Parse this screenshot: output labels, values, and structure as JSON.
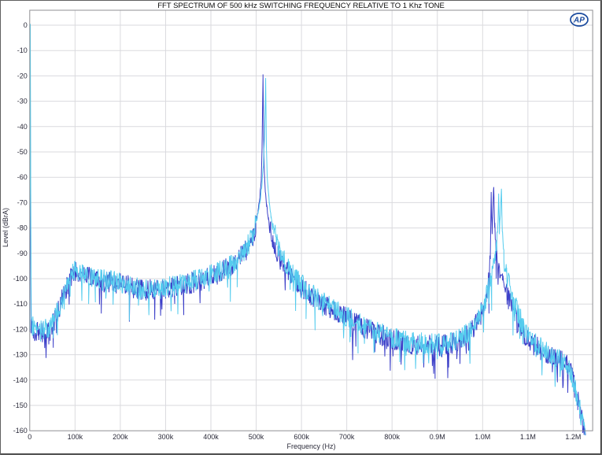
{
  "logo": {
    "text": "AP"
  },
  "chart_data": {
    "type": "line",
    "title": "FFT SPECTRUM OF 500 kHz SWITCHING FREQUENCY RELATIVE TO 1 Khz TONE",
    "xlabel": "Frequency (Hz)",
    "ylabel": "Level (dBrA)",
    "xlim_hz": [
      0,
      1243000
    ],
    "ylim_db": [
      -160,
      6
    ],
    "grid": true,
    "legend": "none",
    "x_ticks": [
      {
        "hz": 0,
        "label": "0"
      },
      {
        "hz": 100000,
        "label": "100k"
      },
      {
        "hz": 200000,
        "label": "200k"
      },
      {
        "hz": 300000,
        "label": "300k"
      },
      {
        "hz": 400000,
        "label": "400k"
      },
      {
        "hz": 500000,
        "label": "500k"
      },
      {
        "hz": 600000,
        "label": "600k"
      },
      {
        "hz": 700000,
        "label": "700k"
      },
      {
        "hz": 800000,
        "label": "800k"
      },
      {
        "hz": 900000,
        "label": "0.9M"
      },
      {
        "hz": 1000000,
        "label": "1.0M"
      },
      {
        "hz": 1100000,
        "label": "1.1M"
      },
      {
        "hz": 1200000,
        "label": "1.2M"
      }
    ],
    "y_ticks": [
      {
        "db": 0,
        "label": "0"
      },
      {
        "db": -10,
        "label": "-10"
      },
      {
        "db": -20,
        "label": "-20"
      },
      {
        "db": -30,
        "label": "-30"
      },
      {
        "db": -40,
        "label": "-40"
      },
      {
        "db": -50,
        "label": "-50"
      },
      {
        "db": -60,
        "label": "-60"
      },
      {
        "db": -70,
        "label": "-70"
      },
      {
        "db": -80,
        "label": "-80"
      },
      {
        "db": -90,
        "label": "-90"
      },
      {
        "db": -100,
        "label": "-100"
      },
      {
        "db": -110,
        "label": "-110"
      },
      {
        "db": -120,
        "label": "-120"
      },
      {
        "db": -130,
        "label": "-130"
      },
      {
        "db": -140,
        "label": "-140"
      },
      {
        "db": -150,
        "label": "-150"
      },
      {
        "db": -160,
        "label": "-160"
      }
    ],
    "series": [
      {
        "name": "fft-trace-blue",
        "color": "#3c3fc8",
        "noise_db": 4.3,
        "points_khz_db": [
          [
            0,
            -118
          ],
          [
            0.6,
            -60
          ],
          [
            1,
            -1
          ],
          [
            1.6,
            -70
          ],
          [
            3,
            -119
          ],
          [
            8,
            -120
          ],
          [
            15,
            -121
          ],
          [
            22,
            -122
          ],
          [
            30,
            -121
          ],
          [
            38,
            -120
          ],
          [
            45,
            -119
          ],
          [
            52,
            -117
          ],
          [
            60,
            -114
          ],
          [
            68,
            -110
          ],
          [
            76,
            -106
          ],
          [
            84,
            -102
          ],
          [
            92,
            -99
          ],
          [
            100,
            -97
          ],
          [
            108,
            -98
          ],
          [
            118,
            -99
          ],
          [
            130,
            -99.5
          ],
          [
            145,
            -100.5
          ],
          [
            160,
            -101
          ],
          [
            180,
            -101.5
          ],
          [
            200,
            -102
          ],
          [
            220,
            -103
          ],
          [
            240,
            -104
          ],
          [
            260,
            -104.5
          ],
          [
            280,
            -104.5
          ],
          [
            300,
            -104
          ],
          [
            320,
            -103.5
          ],
          [
            340,
            -102.5
          ],
          [
            360,
            -101.5
          ],
          [
            380,
            -100.5
          ],
          [
            400,
            -99
          ],
          [
            415,
            -98
          ],
          [
            430,
            -96.5
          ],
          [
            445,
            -95
          ],
          [
            458,
            -93
          ],
          [
            468,
            -91
          ],
          [
            478,
            -88.5
          ],
          [
            486,
            -86
          ],
          [
            493,
            -83
          ],
          [
            499,
            -79
          ],
          [
            504,
            -74
          ],
          [
            508,
            -68
          ],
          [
            511,
            -61
          ],
          [
            513,
            -48
          ],
          [
            515,
            -20.2
          ],
          [
            516.5,
            -45
          ],
          [
            518,
            -58
          ],
          [
            520,
            -65
          ],
          [
            523,
            -71
          ],
          [
            527,
            -76
          ],
          [
            532,
            -81
          ],
          [
            539,
            -86
          ],
          [
            548,
            -90.5
          ],
          [
            560,
            -94.5
          ],
          [
            575,
            -98.5
          ],
          [
            592,
            -102
          ],
          [
            610,
            -105
          ],
          [
            630,
            -107.5
          ],
          [
            652,
            -110.5
          ],
          [
            675,
            -113
          ],
          [
            700,
            -115.5
          ],
          [
            725,
            -118
          ],
          [
            752,
            -120.5
          ],
          [
            780,
            -122.5
          ],
          [
            808,
            -124
          ],
          [
            836,
            -125.5
          ],
          [
            865,
            -126
          ],
          [
            895,
            -126.5
          ],
          [
            920,
            -126
          ],
          [
            942,
            -125
          ],
          [
            960,
            -123
          ],
          [
            976,
            -120
          ],
          [
            989,
            -116.5
          ],
          [
            1000,
            -112.5
          ],
          [
            1008,
            -107
          ],
          [
            1014,
            -99
          ],
          [
            1017,
            -88
          ],
          [
            1019,
            -66
          ],
          [
            1020.5,
            -82
          ],
          [
            1022,
            -76
          ],
          [
            1024.5,
            -63.4
          ],
          [
            1026.5,
            -80
          ],
          [
            1030,
            -90
          ],
          [
            1036,
            -96
          ],
          [
            1044,
            -101
          ],
          [
            1054,
            -106.5
          ],
          [
            1065,
            -112
          ],
          [
            1078,
            -117.5
          ],
          [
            1092,
            -122
          ],
          [
            1108,
            -125.5
          ],
          [
            1128,
            -128
          ],
          [
            1150,
            -130
          ],
          [
            1170,
            -132
          ],
          [
            1185,
            -133.5
          ],
          [
            1194,
            -136
          ],
          [
            1202,
            -142
          ],
          [
            1210,
            -148
          ],
          [
            1217,
            -154
          ],
          [
            1223,
            -159
          ],
          [
            1227,
            -161.5
          ]
        ]
      },
      {
        "name": "fft-trace-cyan",
        "color": "#55ccee",
        "noise_db": 4.3,
        "points_khz_db": [
          [
            0,
            -117
          ],
          [
            0.6,
            -50
          ],
          [
            1.2,
            0
          ],
          [
            2,
            -60
          ],
          [
            3.5,
            -118
          ],
          [
            8,
            -119.5
          ],
          [
            15,
            -120.5
          ],
          [
            22,
            -121
          ],
          [
            30,
            -120.5
          ],
          [
            38,
            -119.5
          ],
          [
            45,
            -118.5
          ],
          [
            52,
            -116.5
          ],
          [
            60,
            -113.5
          ],
          [
            68,
            -109.5
          ],
          [
            76,
            -105.5
          ],
          [
            84,
            -101.5
          ],
          [
            92,
            -98.5
          ],
          [
            100,
            -96.5
          ],
          [
            108,
            -97.5
          ],
          [
            118,
            -98.5
          ],
          [
            130,
            -99
          ],
          [
            145,
            -100
          ],
          [
            160,
            -100.5
          ],
          [
            180,
            -101
          ],
          [
            200,
            -101.5
          ],
          [
            220,
            -102.5
          ],
          [
            240,
            -103.5
          ],
          [
            260,
            -104
          ],
          [
            280,
            -104
          ],
          [
            300,
            -103.5
          ],
          [
            320,
            -103
          ],
          [
            340,
            -102
          ],
          [
            360,
            -101
          ],
          [
            380,
            -100
          ],
          [
            400,
            -98.5
          ],
          [
            415,
            -97.5
          ],
          [
            430,
            -96
          ],
          [
            445,
            -94.5
          ],
          [
            458,
            -92.5
          ],
          [
            468,
            -90.5
          ],
          [
            478,
            -88
          ],
          [
            486,
            -85.5
          ],
          [
            493,
            -82.5
          ],
          [
            499,
            -78.5
          ],
          [
            504,
            -74
          ],
          [
            509,
            -69
          ],
          [
            513,
            -62
          ],
          [
            516,
            -55
          ],
          [
            518.5,
            -44
          ],
          [
            521,
            -21.5
          ],
          [
            522.5,
            -48
          ],
          [
            524,
            -58
          ],
          [
            526,
            -64
          ],
          [
            529,
            -70
          ],
          [
            533,
            -76
          ],
          [
            539,
            -81
          ],
          [
            547,
            -86
          ],
          [
            558,
            -91
          ],
          [
            572,
            -96
          ],
          [
            590,
            -100.5
          ],
          [
            610,
            -104
          ],
          [
            630,
            -107
          ],
          [
            652,
            -110
          ],
          [
            675,
            -112.5
          ],
          [
            700,
            -115
          ],
          [
            725,
            -117.5
          ],
          [
            752,
            -120
          ],
          [
            780,
            -122
          ],
          [
            808,
            -123.5
          ],
          [
            836,
            -125
          ],
          [
            865,
            -125.5
          ],
          [
            895,
            -126
          ],
          [
            920,
            -125.5
          ],
          [
            942,
            -124.5
          ],
          [
            960,
            -122.5
          ],
          [
            976,
            -119.5
          ],
          [
            989,
            -116
          ],
          [
            1000,
            -112
          ],
          [
            1010,
            -106
          ],
          [
            1020,
            -99
          ],
          [
            1028,
            -92
          ],
          [
            1033,
            -84
          ],
          [
            1035.5,
            -67
          ],
          [
            1037,
            -80
          ],
          [
            1039.5,
            -74
          ],
          [
            1041.5,
            -64.5
          ],
          [
            1043.5,
            -82
          ],
          [
            1047,
            -92
          ],
          [
            1053,
            -99
          ],
          [
            1062,
            -105
          ],
          [
            1073,
            -111
          ],
          [
            1086,
            -117
          ],
          [
            1100,
            -121.5
          ],
          [
            1115,
            -125
          ],
          [
            1135,
            -128
          ],
          [
            1156,
            -130.5
          ],
          [
            1175,
            -132.5
          ],
          [
            1189,
            -134.5
          ],
          [
            1198,
            -139
          ],
          [
            1206,
            -145
          ],
          [
            1214,
            -151
          ],
          [
            1220,
            -157
          ],
          [
            1226,
            -161
          ]
        ]
      }
    ],
    "colors": {
      "grid": "#dadade",
      "plot_border": "#8f8f93",
      "background": "#ffffff",
      "logo_blue": "#1a4a9e"
    }
  }
}
